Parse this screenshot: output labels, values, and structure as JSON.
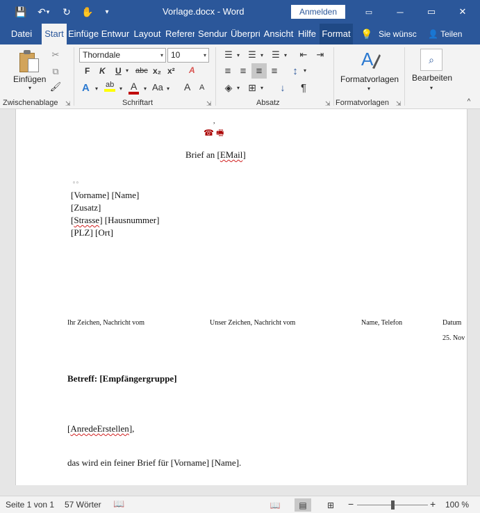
{
  "window": {
    "title": "Vorlage.docx  -  Word",
    "signin_label": "Anmelden",
    "minimize": "─",
    "restore": "▭",
    "close": "✕",
    "ribbon_options": "▭"
  },
  "quick_access": {
    "save": "💾",
    "undo": "↶",
    "undo_dropdown": "▾",
    "redo": "↻",
    "touch": "✋",
    "customize": "▾"
  },
  "tabs": [
    {
      "label": "Datei"
    },
    {
      "label": "Start"
    },
    {
      "label": "Einfüge"
    },
    {
      "label": "Entwur"
    },
    {
      "label": "Layout"
    },
    {
      "label": "Referer"
    },
    {
      "label": "Sendur"
    },
    {
      "label": "Überprü"
    },
    {
      "label": "Ansicht"
    },
    {
      "label": "Hilfe"
    },
    {
      "label": "Format"
    }
  ],
  "tell_me": {
    "icon": "💡",
    "label": "Sie wünsc"
  },
  "share": {
    "label": "Teilen",
    "icon": "👤"
  },
  "ribbon": {
    "clipboard": {
      "label": "Zwischenablage",
      "paste_label": "Einfügen",
      "paste_dropdown": "▾",
      "cut": "✂",
      "copy": "⧉",
      "format_painter": "🖌"
    },
    "font": {
      "label": "Schriftart",
      "name": "Thorndale",
      "size": "10",
      "bold": "F",
      "italic": "K",
      "underline": "U",
      "underline_dropdown": "▾",
      "strikethrough": "abc",
      "subscript": "x₂",
      "superscript": "x²",
      "clear_formatting": "A",
      "text_effects": "A",
      "highlight": "ab",
      "font_color": "A",
      "change_case": "Aa",
      "grow": "A",
      "shrink": "A"
    },
    "paragraph": {
      "label": "Absatz",
      "bullets": "☰",
      "numbering": "☰",
      "multilevel": "☰",
      "decrease_indent": "⇤",
      "increase_indent": "⇥",
      "align_left": "≡",
      "center": "≡",
      "align_right": "≡",
      "justify": "≡",
      "line_spacing": "↕",
      "shading": "◈",
      "borders": "⊞",
      "sort": "↓",
      "show_marks": "¶"
    },
    "styles": {
      "label": "Formatvorlagen",
      "button_label": "Formatvorlagen",
      "dropdown": "▾"
    },
    "editing": {
      "button_label": "Bearbeiten",
      "icon": "⌕",
      "dropdown": "▾"
    },
    "collapse": "^",
    "launcher": "⇲"
  },
  "document": {
    "header_mark": ",",
    "header_icons": "☎ 🖷",
    "letter_to_prefix": "Brief an [",
    "letter_to_field": "EMail",
    "letter_to_suffix": "]",
    "address_marks": "▫  ▫",
    "address": {
      "line1": "[Vorname] [Name]",
      "line2": "[Zusatz]",
      "line3_open": "[",
      "line3_field": "Strasse",
      "line3_rest": "] [Hausnummer]",
      "line4": "[PLZ] [Ort]"
    },
    "info_headers": [
      "Ihr Zeichen, Nachricht vom",
      "Unser Zeichen, Nachricht vom",
      "Name, Telefon",
      "Datum"
    ],
    "date": "25. Nov",
    "subject": "Betreff: [Empfängergruppe]",
    "salutation_open": "[",
    "salutation_field": "AnredeErstellen",
    "salutation_close": "],",
    "body": "das wird ein feiner Brief für [Vorname] [Name]."
  },
  "statusbar": {
    "page": "Seite 1 von 1",
    "words": "57 Wörter",
    "proofing_icon": "📖",
    "read_mode_icon": "📖",
    "print_layout_icon": "▤",
    "web_layout_icon": "⊞",
    "zoom_out": "−",
    "zoom_in": "+",
    "zoom": "100 %",
    "zoom_percent": 100
  },
  "colors": {
    "brand": "#2b579a",
    "ribbon_bg": "#f3f3f3",
    "highlight": "#ffff00",
    "font_color": "#c00000",
    "squiggle": "#d12020"
  }
}
